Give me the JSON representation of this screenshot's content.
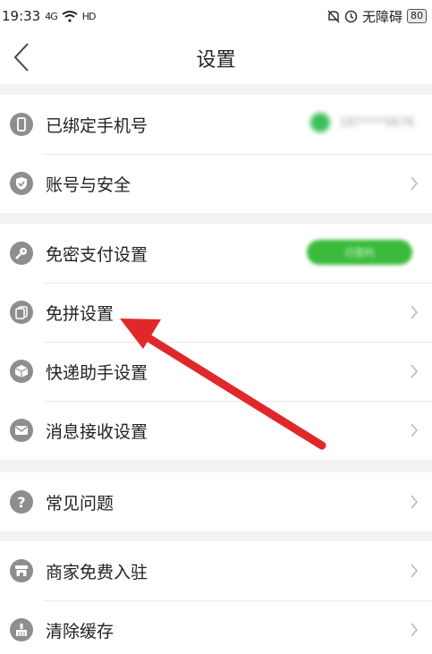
{
  "status_bar": {
    "time": "19:33",
    "signal_text": "4G",
    "wifi_text": "HD",
    "accessibility_label": "无障碍",
    "battery": "80"
  },
  "header": {
    "title": "设置"
  },
  "groups": [
    {
      "items": [
        {
          "label": "已绑定手机号",
          "icon": "phone-icon",
          "value": "187****5676"
        },
        {
          "label": "账号与安全",
          "icon": "shield-icon"
        }
      ]
    },
    {
      "items": [
        {
          "label": "免密支付设置",
          "icon": "key-icon",
          "value": "已签约"
        },
        {
          "label": "免拼设置",
          "icon": "free-group-icon",
          "value": ""
        },
        {
          "label": "快递助手设置",
          "icon": "package-icon"
        },
        {
          "label": "消息接收设置",
          "icon": "mail-icon"
        }
      ]
    },
    {
      "items": [
        {
          "label": "常见问题",
          "icon": "question-icon"
        }
      ]
    },
    {
      "items": [
        {
          "label": "商家免费入驻",
          "icon": "store-icon"
        },
        {
          "label": "清除缓存",
          "icon": "broom-icon"
        }
      ]
    }
  ],
  "colors": {
    "accent_green": "#3cc15a",
    "arrow_red": "#e0282b",
    "icon_gray": "#8e8e8e"
  }
}
